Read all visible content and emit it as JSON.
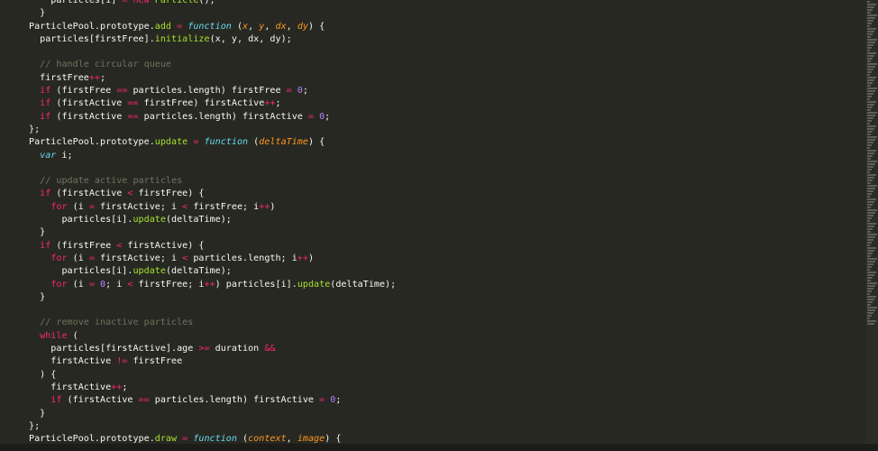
{
  "theme": {
    "background": "#272822",
    "keyword": "#f92672",
    "storage": "#66d9ef",
    "function": "#a6e22e",
    "number": "#ae81ff",
    "parameter": "#fd971f",
    "comment": "#75715e",
    "text": "#f8f8f2"
  },
  "code_lines": [
    [
      [
        "    particles[i] ",
        "plain"
      ],
      [
        "=",
        "kw"
      ],
      [
        " ",
        "plain"
      ],
      [
        "new",
        "kw"
      ],
      [
        " ",
        "plain"
      ],
      [
        "Particle",
        "fn"
      ],
      [
        "();",
        "plain"
      ]
    ],
    [
      [
        "  }",
        "plain"
      ]
    ],
    [
      [
        "ParticlePool.prototype.",
        "plain"
      ],
      [
        "add",
        "fn"
      ],
      [
        " ",
        "plain"
      ],
      [
        "=",
        "kw"
      ],
      [
        " ",
        "plain"
      ],
      [
        "function",
        "storage"
      ],
      [
        " (",
        "plain"
      ],
      [
        "x",
        "param"
      ],
      [
        ", ",
        "plain"
      ],
      [
        "y",
        "param"
      ],
      [
        ", ",
        "plain"
      ],
      [
        "dx",
        "param"
      ],
      [
        ", ",
        "plain"
      ],
      [
        "dy",
        "param"
      ],
      [
        ") {",
        "plain"
      ]
    ],
    [
      [
        "  particles[firstFree].",
        "plain"
      ],
      [
        "initialize",
        "fn"
      ],
      [
        "(x, y, dx, dy);",
        "plain"
      ]
    ],
    [
      [
        "",
        "plain"
      ]
    ],
    [
      [
        "  // handle circular queue",
        "comment"
      ]
    ],
    [
      [
        "  firstFree",
        "plain"
      ],
      [
        "++",
        "kw"
      ],
      [
        ";",
        "plain"
      ]
    ],
    [
      [
        "  ",
        "plain"
      ],
      [
        "if",
        "kw"
      ],
      [
        " (firstFree ",
        "plain"
      ],
      [
        "==",
        "kw"
      ],
      [
        " particles.length) firstFree ",
        "plain"
      ],
      [
        "=",
        "kw"
      ],
      [
        " ",
        "plain"
      ],
      [
        "0",
        "num"
      ],
      [
        ";",
        "plain"
      ]
    ],
    [
      [
        "  ",
        "plain"
      ],
      [
        "if",
        "kw"
      ],
      [
        " (firstActive ",
        "plain"
      ],
      [
        "==",
        "kw"
      ],
      [
        " firstFree) firstActive",
        "plain"
      ],
      [
        "++",
        "kw"
      ],
      [
        ";",
        "plain"
      ]
    ],
    [
      [
        "  ",
        "plain"
      ],
      [
        "if",
        "kw"
      ],
      [
        " (firstActive ",
        "plain"
      ],
      [
        "==",
        "kw"
      ],
      [
        " particles.length) firstActive ",
        "plain"
      ],
      [
        "=",
        "kw"
      ],
      [
        " ",
        "plain"
      ],
      [
        "0",
        "num"
      ],
      [
        ";",
        "plain"
      ]
    ],
    [
      [
        "};",
        "plain"
      ]
    ],
    [
      [
        "ParticlePool.prototype.",
        "plain"
      ],
      [
        "update",
        "fn"
      ],
      [
        " ",
        "plain"
      ],
      [
        "=",
        "kw"
      ],
      [
        " ",
        "plain"
      ],
      [
        "function",
        "storage"
      ],
      [
        " (",
        "plain"
      ],
      [
        "deltaTime",
        "param"
      ],
      [
        ") {",
        "plain"
      ]
    ],
    [
      [
        "  ",
        "plain"
      ],
      [
        "var",
        "storage"
      ],
      [
        " i;",
        "plain"
      ]
    ],
    [
      [
        "",
        "plain"
      ]
    ],
    [
      [
        "  // update active particles",
        "comment"
      ]
    ],
    [
      [
        "  ",
        "plain"
      ],
      [
        "if",
        "kw"
      ],
      [
        " (firstActive ",
        "plain"
      ],
      [
        "<",
        "kw"
      ],
      [
        " firstFree) {",
        "plain"
      ]
    ],
    [
      [
        "    ",
        "plain"
      ],
      [
        "for",
        "kw"
      ],
      [
        " (i ",
        "plain"
      ],
      [
        "=",
        "kw"
      ],
      [
        " firstActive; i ",
        "plain"
      ],
      [
        "<",
        "kw"
      ],
      [
        " firstFree; i",
        "plain"
      ],
      [
        "++",
        "kw"
      ],
      [
        ")",
        "plain"
      ]
    ],
    [
      [
        "      particles[i].",
        "plain"
      ],
      [
        "update",
        "fn"
      ],
      [
        "(deltaTime);",
        "plain"
      ]
    ],
    [
      [
        "  }",
        "plain"
      ]
    ],
    [
      [
        "  ",
        "plain"
      ],
      [
        "if",
        "kw"
      ],
      [
        " (firstFree ",
        "plain"
      ],
      [
        "<",
        "kw"
      ],
      [
        " firstActive) {",
        "plain"
      ]
    ],
    [
      [
        "    ",
        "plain"
      ],
      [
        "for",
        "kw"
      ],
      [
        " (i ",
        "plain"
      ],
      [
        "=",
        "kw"
      ],
      [
        " firstActive; i ",
        "plain"
      ],
      [
        "<",
        "kw"
      ],
      [
        " particles.length; i",
        "plain"
      ],
      [
        "++",
        "kw"
      ],
      [
        ")",
        "plain"
      ]
    ],
    [
      [
        "      particles[i].",
        "plain"
      ],
      [
        "update",
        "fn"
      ],
      [
        "(deltaTime);",
        "plain"
      ]
    ],
    [
      [
        "    ",
        "plain"
      ],
      [
        "for",
        "kw"
      ],
      [
        " (i ",
        "plain"
      ],
      [
        "=",
        "kw"
      ],
      [
        " ",
        "plain"
      ],
      [
        "0",
        "num"
      ],
      [
        "; i ",
        "plain"
      ],
      [
        "<",
        "kw"
      ],
      [
        " firstFree; i",
        "plain"
      ],
      [
        "++",
        "kw"
      ],
      [
        ") particles[i].",
        "plain"
      ],
      [
        "update",
        "fn"
      ],
      [
        "(deltaTime);",
        "plain"
      ]
    ],
    [
      [
        "  }",
        "plain"
      ]
    ],
    [
      [
        "",
        "plain"
      ]
    ],
    [
      [
        "  // remove inactive particles",
        "comment"
      ]
    ],
    [
      [
        "  ",
        "plain"
      ],
      [
        "while",
        "kw"
      ],
      [
        " (",
        "plain"
      ]
    ],
    [
      [
        "    particles[firstActive].age ",
        "plain"
      ],
      [
        ">=",
        "kw"
      ],
      [
        " duration ",
        "plain"
      ],
      [
        "&&",
        "kw"
      ]
    ],
    [
      [
        "    firstActive ",
        "plain"
      ],
      [
        "!=",
        "kw"
      ],
      [
        " firstFree",
        "plain"
      ]
    ],
    [
      [
        "  ) {",
        "plain"
      ]
    ],
    [
      [
        "    firstActive",
        "plain"
      ],
      [
        "++",
        "kw"
      ],
      [
        ";",
        "plain"
      ]
    ],
    [
      [
        "    ",
        "plain"
      ],
      [
        "if",
        "kw"
      ],
      [
        " (firstActive ",
        "plain"
      ],
      [
        "==",
        "kw"
      ],
      [
        " particles.length) firstActive ",
        "plain"
      ],
      [
        "=",
        "kw"
      ],
      [
        " ",
        "plain"
      ],
      [
        "0",
        "num"
      ],
      [
        ";",
        "plain"
      ]
    ],
    [
      [
        "  }",
        "plain"
      ]
    ],
    [
      [
        "};",
        "plain"
      ]
    ],
    [
      [
        "ParticlePool.prototype.",
        "plain"
      ],
      [
        "draw",
        "fn"
      ],
      [
        " ",
        "plain"
      ],
      [
        "=",
        "kw"
      ],
      [
        " ",
        "plain"
      ],
      [
        "function",
        "storage"
      ],
      [
        " (",
        "plain"
      ],
      [
        "context",
        "param"
      ],
      [
        ", ",
        "plain"
      ],
      [
        "image",
        "param"
      ],
      [
        ") {",
        "plain"
      ]
    ]
  ]
}
